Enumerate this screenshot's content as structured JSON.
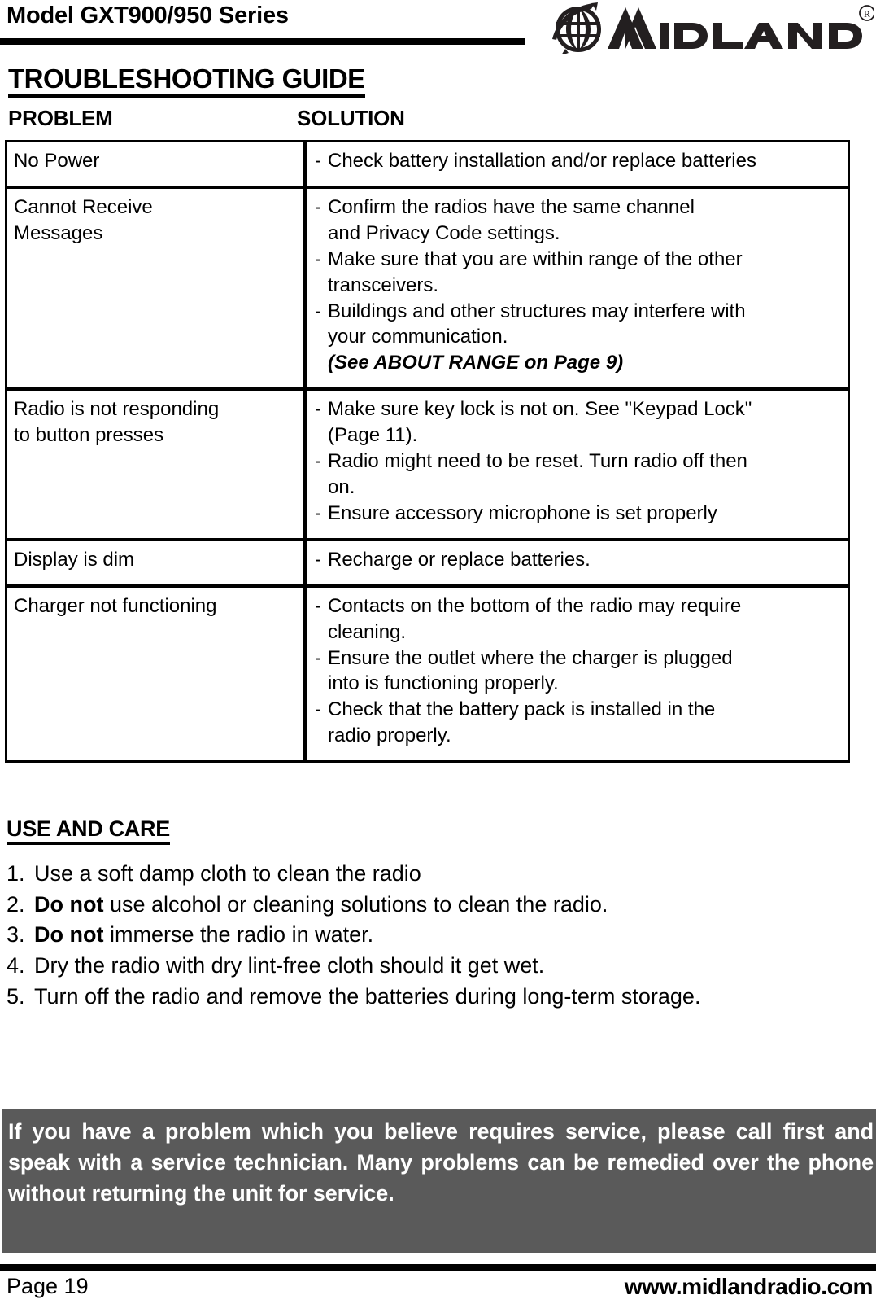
{
  "header": {
    "model_title": "Model GXT900/950 Series",
    "brand": {
      "name": "MIDLAND",
      "registered_mark": "®",
      "globe_icon": "globe-icon"
    }
  },
  "guide": {
    "title": "TROUBLESHOOTING GUIDE",
    "columns": {
      "problem": "PROBLEM",
      "solution": "SOLUTION"
    },
    "rows": [
      {
        "problem_lines": [
          "No Power"
        ],
        "solutions": [
          {
            "bullet": "-",
            "lines": [
              "Check battery installation and/or replace batteries"
            ]
          }
        ],
        "note": ""
      },
      {
        "problem_lines": [
          "Cannot Receive",
          "Messages"
        ],
        "solutions": [
          {
            "bullet": "-",
            "lines": [
              "Confirm the radios have the same channel",
              "and Privacy Code settings."
            ]
          },
          {
            "bullet": "-",
            "lines": [
              "Make sure that you are within range of the other",
              "transceivers."
            ]
          },
          {
            "bullet": "-",
            "lines": [
              "Buildings and other structures may interfere with",
              "your communication."
            ]
          }
        ],
        "note": "(See ABOUT RANGE on Page 9)"
      },
      {
        "problem_lines": [
          "Radio is not responding",
          "to button presses"
        ],
        "solutions": [
          {
            "bullet": "-",
            "lines": [
              "Make sure key lock is not on. See \"Keypad Lock\"",
              "(Page 11)."
            ]
          },
          {
            "bullet": "-",
            "lines": [
              "Radio might need to be reset.  Turn radio off then",
              "on."
            ]
          },
          {
            "bullet": "-",
            "lines": [
              "Ensure accessory microphone is set properly"
            ]
          }
        ],
        "note": ""
      },
      {
        "problem_lines": [
          "Display is dim"
        ],
        "solutions": [
          {
            "bullet": "-",
            "lines": [
              "Recharge or replace batteries."
            ]
          }
        ],
        "note": ""
      },
      {
        "problem_lines": [
          "Charger not functioning"
        ],
        "solutions": [
          {
            "bullet": "-",
            "lines": [
              "Contacts on the bottom of the radio may require",
              "cleaning."
            ]
          },
          {
            "bullet": "-",
            "lines": [
              "Ensure the outlet where the charger is plugged",
              "into is functioning properly."
            ]
          },
          {
            "bullet": "-",
            "lines": [
              "Check that the battery pack is installed in the",
              "radio properly."
            ]
          }
        ],
        "note": ""
      }
    ]
  },
  "use_and_care": {
    "title": "USE AND CARE",
    "items": [
      {
        "number": "1.",
        "bold": "",
        "text": "Use a soft damp cloth to clean the radio"
      },
      {
        "number": "2.",
        "bold": "Do not",
        "text": " use alcohol or cleaning solutions to clean the radio."
      },
      {
        "number": "3.",
        "bold": "Do not",
        "text": " immerse the radio in water."
      },
      {
        "number": "4.",
        "bold": "",
        "text": "Dry the radio with dry lint-free cloth should it get wet."
      },
      {
        "number": "5.",
        "bold": "",
        "text": "Turn off the radio and remove the batteries during long-term storage."
      }
    ]
  },
  "notice": {
    "text": "If you have a problem which you believe requires service, please call first and speak with a service technician.  Many problems can be remedied over the phone without returning the unit for service.",
    "background_color": "#5a5a5a",
    "text_color": "#ffffff"
  },
  "footer": {
    "page_label": "Page 19",
    "website": "www.midlandradio.com"
  }
}
